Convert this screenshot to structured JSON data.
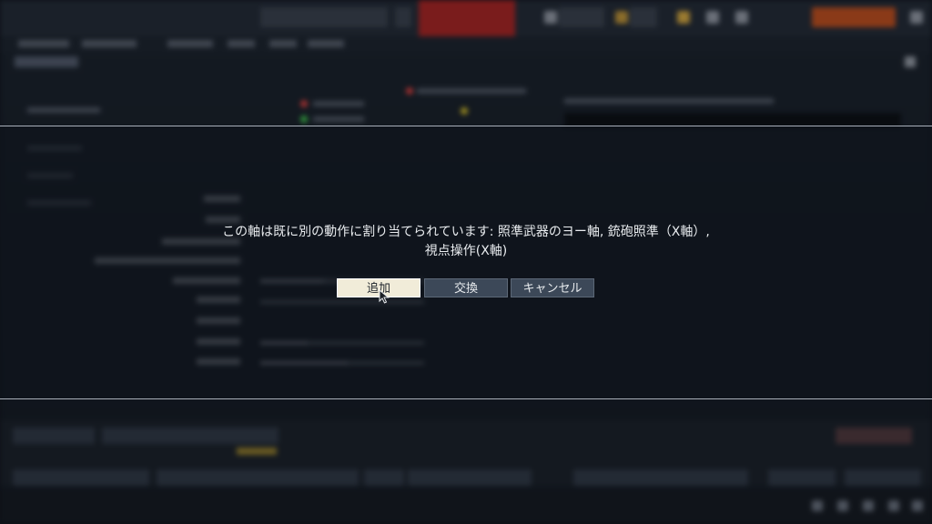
{
  "dialog": {
    "message_line1": "この軸は既に別の動作に割り当てられています: 照準武器のヨー軸, 銃砲照準（X軸）,",
    "message_line2": "視点操作(X軸)",
    "buttons": {
      "add": "追加",
      "swap": "交換",
      "cancel": "キャンセル"
    }
  },
  "colors": {
    "primary_button_bg": "#f1ecd9",
    "button_bg": "#3c4858",
    "dialog_border": "#a9b0ba"
  }
}
